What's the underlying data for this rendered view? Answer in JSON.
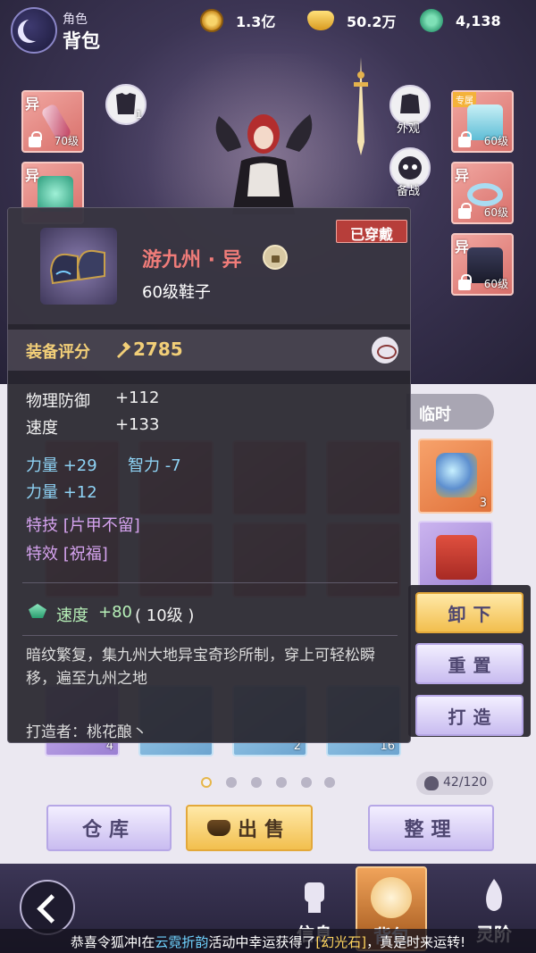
{
  "header": {
    "role_label": "角色",
    "title": "背包"
  },
  "currencies": [
    {
      "icon": "coin-icon",
      "value": "1.3亿"
    },
    {
      "icon": "ingot-icon",
      "value": "50.2万"
    },
    {
      "icon": "jade-icon",
      "value": "4,138"
    }
  ],
  "equipment_left": [
    {
      "tag": "异",
      "level": "70级"
    },
    {
      "tag": "异",
      "level": ""
    }
  ],
  "equipment_right": [
    {
      "tag": "专属",
      "level": "60级"
    },
    {
      "tag": "异",
      "level": "60级"
    },
    {
      "tag": "异",
      "level": "60级"
    }
  ],
  "armor_count": "1",
  "scene_buttons": {
    "appearance": "外观",
    "standby": "备战"
  },
  "bag_tabs": {
    "temp": "临时"
  },
  "grid_counts": [
    "3",
    "4",
    "2",
    "16"
  ],
  "pagination": {
    "pages": 6,
    "active": 0
  },
  "capacity": "42/120",
  "actions": {
    "warehouse": "仓库",
    "sell": "出售",
    "sort": "整理"
  },
  "nav": {
    "info": "信息",
    "bag": "背包",
    "rank": "灵阶"
  },
  "ticker": {
    "prefix": "恭喜令狐冲I在",
    "event": "云霓折韵",
    "middle": "活动中幸运获得了",
    "item": "[幻光石]",
    "suffix": "，真是时来运转!"
  },
  "tooltip": {
    "name": "游九州 · 异",
    "type": "60级鞋子",
    "equipped": "已穿戴",
    "score_label": "装备评分",
    "score": "2785",
    "base_stats": [
      {
        "label": "物理防御",
        "value": "+112"
      },
      {
        "label": "速度",
        "value": "+133"
      }
    ],
    "attr_line1": [
      "力量 +29",
      "智力 -7"
    ],
    "attr_line2": "力量 +12",
    "skill": "特技 [片甲不留]",
    "effect": "特效 [祝福]",
    "gem_stat": "速度",
    "gem_value": "+80",
    "gem_level": "( 10级 )",
    "description": "暗纹繁复，集九州大地异宝奇珍所制，穿上可轻松瞬移，遍至九州之地",
    "crafter": "打造者：桃花酿丶"
  },
  "side_actions": {
    "unequip": "卸下",
    "reset": "重置",
    "forge": "打造"
  },
  "colors": {
    "item_name": "#f07c79",
    "score": "#f2cf78",
    "attr": "#8ed3f5",
    "special": "#d5a3ef",
    "gem": "#b7f0b8"
  }
}
